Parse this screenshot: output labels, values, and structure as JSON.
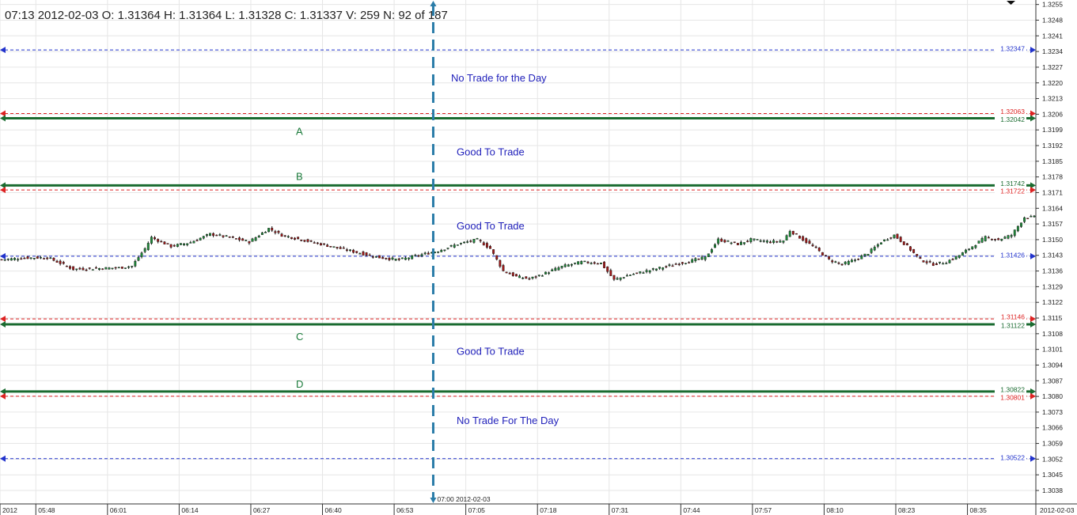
{
  "header": {
    "text": "07:13 2012-02-03  O: 1.31364  H: 1.31364  L: 1.31328  C: 1.31337  V: 259  N: 92 of 187"
  },
  "colors": {
    "up_candle": "#1f8a3a",
    "down_candle": "#a01818",
    "grid": "#e6e6e6",
    "level_green": "#1a6b30",
    "level_red": "#dd2222",
    "level_blue": "#2233cc",
    "cursor": "#2a7ca8",
    "zone_text": "#2222bb"
  },
  "chart_data": {
    "type": "candlestick",
    "title": "",
    "y_range": [
      1.3032,
      1.3257
    ],
    "y_ticks": [
      "1.3255",
      "1.3248",
      "1.3241",
      "1.3234",
      "1.3227",
      "1.3220",
      "1.3213",
      "1.3206",
      "1.3199",
      "1.3192",
      "1.3185",
      "1.3178",
      "1.3171",
      "1.3164",
      "1.3157",
      "1.3150",
      "1.3143",
      "1.3136",
      "1.3129",
      "1.3122",
      "1.3115",
      "1.3108",
      "1.3101",
      "1.3094",
      "1.3087",
      "1.3080",
      "1.3073",
      "1.3066",
      "1.3059",
      "1.3052",
      "1.3045",
      "1.3038"
    ],
    "x_ticks": [
      {
        "bar": 0,
        "label": "2012"
      },
      {
        "bar": 11,
        "label": "05:48"
      },
      {
        "bar": 33,
        "label": "06:01"
      },
      {
        "bar": 55,
        "label": "06:14"
      },
      {
        "bar": 77,
        "label": "06:27"
      },
      {
        "bar": 99,
        "label": "06:40"
      },
      {
        "bar": 121,
        "label": "06:53"
      },
      {
        "bar": 143,
        "label": "07:05"
      },
      {
        "bar": 165,
        "label": "07:18"
      },
      {
        "bar": 187,
        "label": "07:31"
      },
      {
        "bar": 209,
        "label": "07:44"
      },
      {
        "bar": 231,
        "label": "07:57"
      },
      {
        "bar": 253,
        "label": "08:10"
      },
      {
        "bar": 275,
        "label": "08:23"
      },
      {
        "bar": 297,
        "label": "08:35"
      }
    ],
    "date_label": "2012-02-03",
    "cursor": {
      "bar": 133,
      "label": "07:00 2012-02-03"
    },
    "levels": [
      {
        "price": 1.32347,
        "label": "1.32347",
        "color": "blue",
        "style": "dashed"
      },
      {
        "price": 1.32063,
        "label": "1.32063",
        "color": "red",
        "style": "dashed"
      },
      {
        "price": 1.32042,
        "label": "1.32042",
        "color": "green",
        "style": "solid"
      },
      {
        "price": 1.31742,
        "label": "1.31742",
        "color": "green",
        "style": "solid"
      },
      {
        "price": 1.31722,
        "label": "1.31722",
        "color": "red",
        "style": "dashed"
      },
      {
        "price": 1.31426,
        "label": "1.31426",
        "color": "blue",
        "style": "dashed"
      },
      {
        "price": 1.31146,
        "label": "1.31146",
        "color": "red",
        "style": "dashed"
      },
      {
        "price": 1.31122,
        "label": "1.31122",
        "color": "green",
        "style": "solid"
      },
      {
        "price": 1.30822,
        "label": "1.30822",
        "color": "green",
        "style": "solid"
      },
      {
        "price": 1.30801,
        "label": "1.30801",
        "color": "red",
        "style": "dashed"
      },
      {
        "price": 1.30522,
        "label": "1.30522",
        "color": "blue",
        "style": "dashed"
      }
    ],
    "line_letters": [
      {
        "letter": "A",
        "price": 1.32042
      },
      {
        "letter": "B",
        "price": 1.31742
      },
      {
        "letter": "C",
        "price": 1.31122
      },
      {
        "letter": "D",
        "price": 1.30822
      }
    ],
    "zones": [
      {
        "text": "No Trade for the Day",
        "price": 1.3222
      },
      {
        "text": "Good To Trade",
        "price": 1.3189
      },
      {
        "text": "Good To Trade",
        "price": 1.3156
      },
      {
        "text": "Good To Trade",
        "price": 1.31
      },
      {
        "text": "No Trade For The Day",
        "price": 1.3069
      }
    ],
    "bar_count": 318,
    "key_closes": [
      [
        0,
        1.31411
      ],
      [
        8,
        1.31419
      ],
      [
        14,
        1.3142
      ],
      [
        18,
        1.31395
      ],
      [
        22,
        1.31368
      ],
      [
        30,
        1.31372
      ],
      [
        36,
        1.31374
      ],
      [
        40,
        1.31382
      ],
      [
        44,
        1.3146
      ],
      [
        46,
        1.3151
      ],
      [
        52,
        1.3147
      ],
      [
        58,
        1.31488
      ],
      [
        64,
        1.31525
      ],
      [
        70,
        1.3151
      ],
      [
        76,
        1.3149
      ],
      [
        82,
        1.3155
      ],
      [
        86,
        1.3152
      ],
      [
        92,
        1.315
      ],
      [
        98,
        1.3148
      ],
      [
        104,
        1.3146
      ],
      [
        110,
        1.3144
      ],
      [
        116,
        1.3142
      ],
      [
        122,
        1.3141
      ],
      [
        128,
        1.3143
      ],
      [
        134,
        1.3145
      ],
      [
        140,
        1.3148
      ],
      [
        146,
        1.315
      ],
      [
        150,
        1.3146
      ],
      [
        154,
        1.3136
      ],
      [
        158,
        1.31335
      ],
      [
        162,
        1.31325
      ],
      [
        166,
        1.31345
      ],
      [
        172,
        1.3138
      ],
      [
        178,
        1.314
      ],
      [
        184,
        1.31395
      ],
      [
        188,
        1.3132
      ],
      [
        192,
        1.3134
      ],
      [
        198,
        1.3136
      ],
      [
        204,
        1.3138
      ],
      [
        210,
        1.314
      ],
      [
        216,
        1.3142
      ],
      [
        220,
        1.315
      ],
      [
        226,
        1.3148
      ],
      [
        230,
        1.315
      ],
      [
        236,
        1.3149
      ],
      [
        240,
        1.31495
      ],
      [
        242,
        1.3154
      ],
      [
        246,
        1.315
      ],
      [
        250,
        1.3146
      ],
      [
        254,
        1.3141
      ],
      [
        258,
        1.3139
      ],
      [
        262,
        1.3141
      ],
      [
        266,
        1.3144
      ],
      [
        270,
        1.3149
      ],
      [
        274,
        1.3152
      ],
      [
        278,
        1.3147
      ],
      [
        282,
        1.3141
      ],
      [
        286,
        1.3139
      ],
      [
        290,
        1.314
      ],
      [
        294,
        1.3143
      ],
      [
        298,
        1.3147
      ],
      [
        302,
        1.3151
      ],
      [
        306,
        1.315
      ],
      [
        310,
        1.3152
      ],
      [
        314,
        1.316
      ],
      [
        317,
        1.316
      ]
    ]
  }
}
